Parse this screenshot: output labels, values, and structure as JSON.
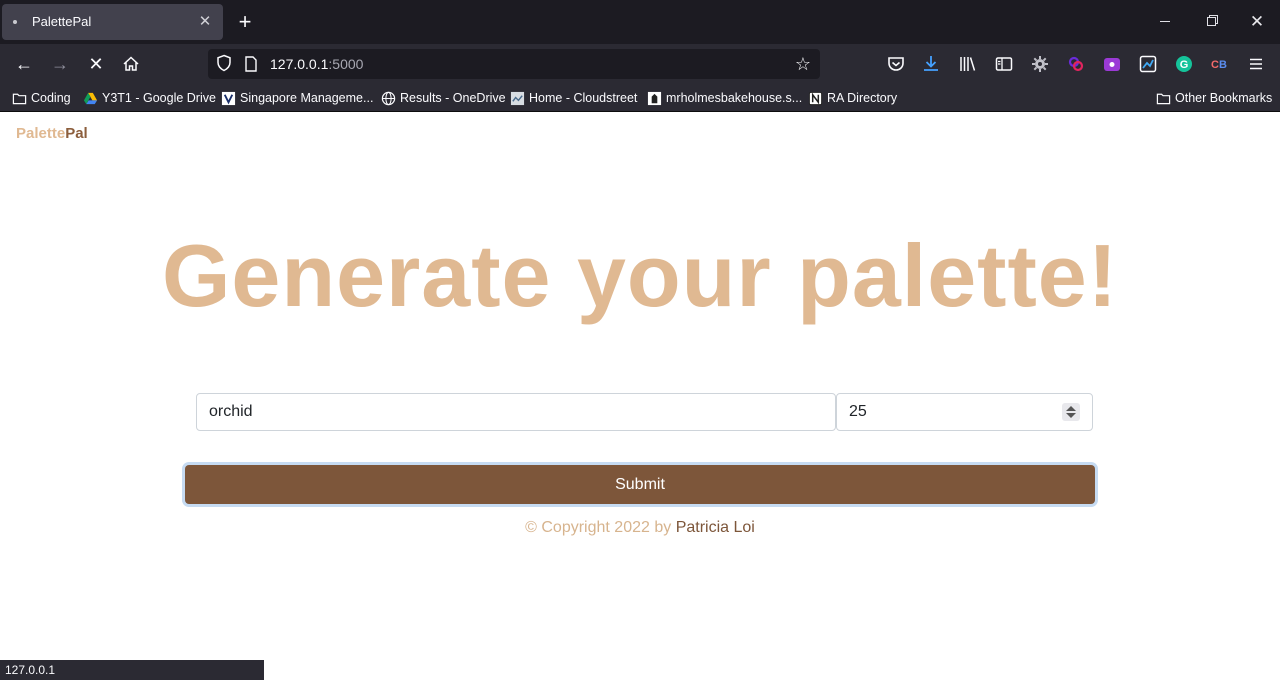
{
  "browser": {
    "tab": {
      "title": "PalettePal"
    },
    "url": {
      "host": "127.0.0.1",
      "port": ":5000"
    },
    "extension_badge": "0",
    "bookmarks": [
      {
        "label": "Coding",
        "icon": "folder-icon"
      },
      {
        "label": "Y3T1 - Google Drive",
        "icon": "google-drive-icon"
      },
      {
        "label": "Singapore Manageme...",
        "icon": "smu-icon"
      },
      {
        "label": "Results - OneDrive",
        "icon": "globe-icon"
      },
      {
        "label": "Home - Cloudstreet",
        "icon": "cloudstreet-icon"
      },
      {
        "label": "mrholmesbakehouse.s...",
        "icon": "bakehouse-icon"
      },
      {
        "label": "RA Directory",
        "icon": "notion-icon"
      }
    ],
    "other_bookmarks": "Other Bookmarks",
    "status_text": "127.0.0.1"
  },
  "page": {
    "brand": {
      "part1": "Palette",
      "part2": "Pal"
    },
    "headline": "Generate your palette!",
    "form": {
      "name_value": "orchid",
      "count_value": "25",
      "submit_label": "Submit"
    },
    "footer": {
      "prefix": "© Copyright 2022 by ",
      "name": "Patricia Loi"
    }
  },
  "colors": {
    "accent_light": "#e0b992",
    "accent_dark": "#7d563a"
  }
}
